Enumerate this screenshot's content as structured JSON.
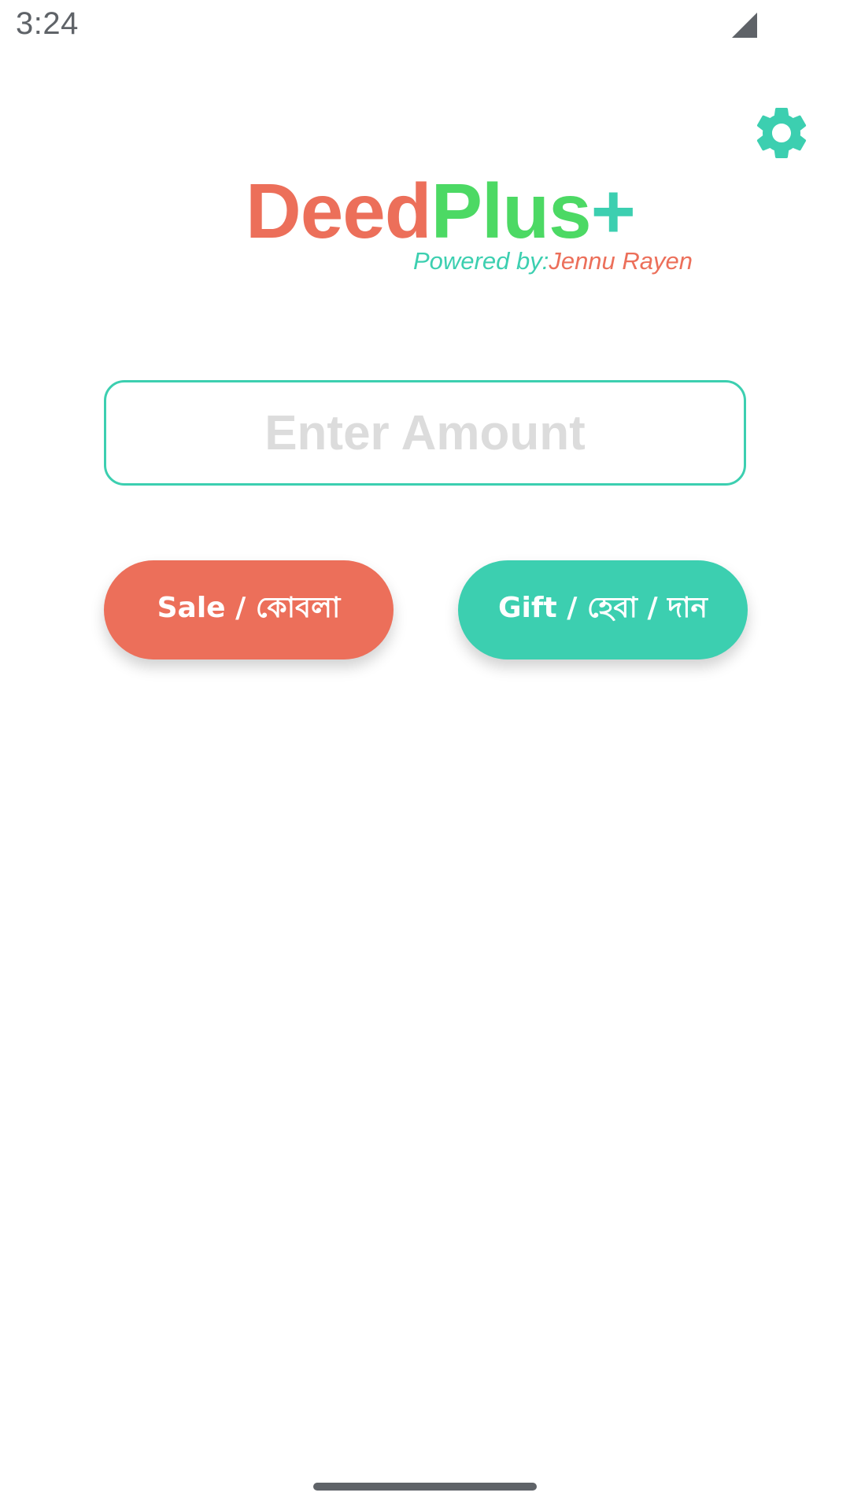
{
  "status_bar": {
    "time": "3:24",
    "signal_icon": "cellular-signal-icon"
  },
  "header": {
    "settings_icon": "gear-icon"
  },
  "logo": {
    "part1": "Deed",
    "part2": "Plus",
    "part3": "+",
    "powered_label": "Powered by:",
    "powered_name": "Jennu Rayen"
  },
  "amount": {
    "value": "",
    "placeholder": "Enter Amount"
  },
  "buttons": {
    "sale_label": "Sale / কোবলা",
    "gift_label": "Gift / হেবা / দান"
  },
  "colors": {
    "coral": "#ec6f5a",
    "green": "#4cd964",
    "teal": "#3ccfb0",
    "placeholder_gray": "#dcdcdc"
  }
}
